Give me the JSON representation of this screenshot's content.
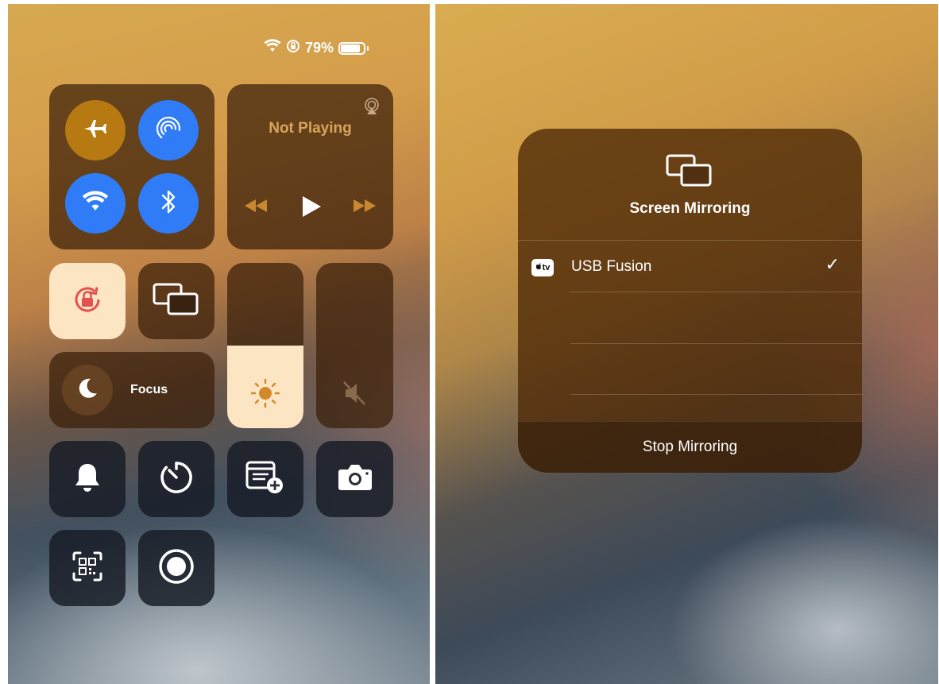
{
  "status_bar": {
    "battery_percent": "79%",
    "battery_level": 0.79,
    "icons": [
      "wifi-icon",
      "orientation-lock-icon",
      "battery-icon"
    ]
  },
  "connectivity": {
    "airplane_mode": "airplane-icon",
    "airdrop": "airdrop-icon",
    "wifi": "wifi-icon",
    "bluetooth": "bluetooth-icon"
  },
  "now_playing": {
    "title": "Not Playing",
    "icons": [
      "airplay-icon",
      "rewind-icon",
      "play-icon",
      "fast-forward-icon"
    ]
  },
  "focus": {
    "label": "Focus"
  },
  "sliders": {
    "brightness_level": 0.5,
    "volume_level": 0.0
  },
  "modal": {
    "title": "Screen Mirroring",
    "device_badge": "tv",
    "device_name": "USB Fusion",
    "checkmark": "✓",
    "stop_label": "Stop Mirroring"
  },
  "colors": {
    "accent_blue": "#2f7cf6",
    "airplane_orange": "#b77a12",
    "orientation_lock_tile": "#fbe5c3",
    "brightness_fill": "#fbe5c3",
    "now_playing_text": "#d6a45a"
  }
}
